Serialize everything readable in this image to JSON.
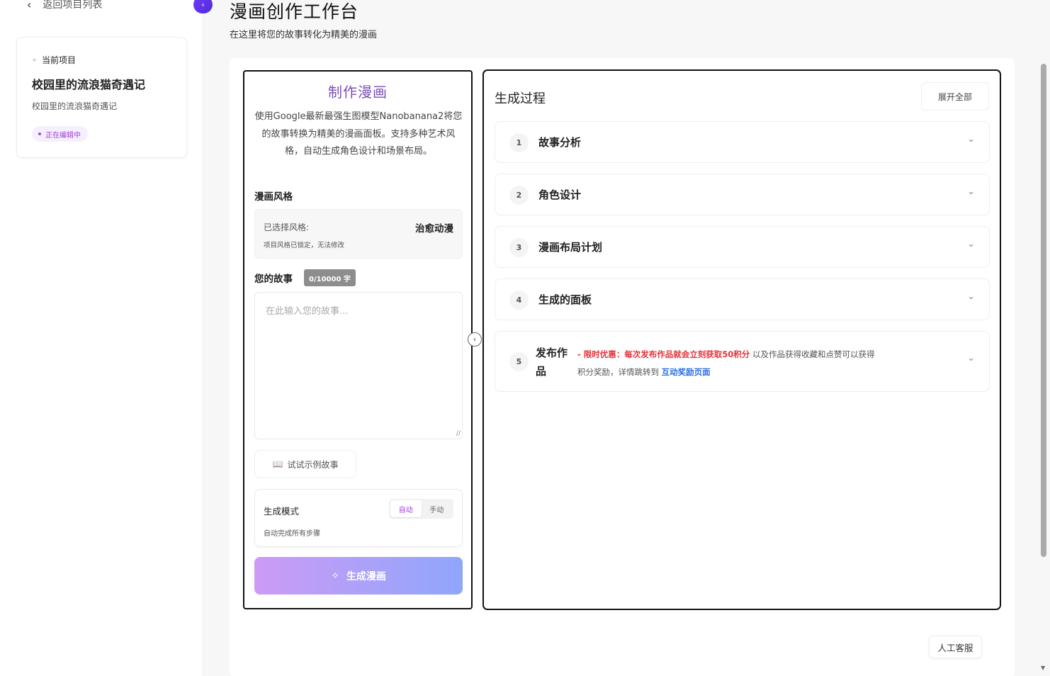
{
  "sidebar": {
    "back_label": "返回项目列表",
    "current_project_label": "当前项目",
    "project_title": "校园里的流浪猫奇遇记",
    "project_subtitle": "校园里的流浪猫奇遇记",
    "status_badge": "正在编辑中"
  },
  "header": {
    "title": "漫画创作工作台",
    "subtitle": "在这里将您的故事转化为精美的漫画"
  },
  "left_panel": {
    "title": "制作漫画",
    "description": "使用Google最新最强生图模型Nanobanana2将您的故事转换为精美的漫画面板。支持多种艺术风格，自动生成角色设计和场景布局。",
    "style_section": "漫画风格",
    "selected_style_label": "已选择风格:",
    "selected_style_value": "治愈动漫",
    "style_locked_note": "项目风格已锁定，无法修改",
    "story_section": "您的故事",
    "char_count": "0/10000 字",
    "story_placeholder": "在此输入您的故事...",
    "example_button": "试试示例故事",
    "mode_label": "生成模式",
    "mode_options": [
      "自动",
      "手动"
    ],
    "mode_hint": "自动完成所有步骤",
    "generate_button": "生成漫画"
  },
  "right_panel": {
    "title": "生成过程",
    "expand_all": "展开全部",
    "steps": [
      {
        "num": "1",
        "name": "故事分析"
      },
      {
        "num": "2",
        "name": "角色设计"
      },
      {
        "num": "3",
        "name": "漫画布局计划"
      },
      {
        "num": "4",
        "name": "生成的面板"
      },
      {
        "num": "5",
        "name": "发布作品"
      }
    ],
    "promo_prefix": "- ",
    "promo_highlight": "限时优惠：每次发布作品就会立刻获取50积分",
    "promo_mid": " 以及作品获得收藏和点赞可以获得积分奖励，详情跳转到 ",
    "promo_link": "互动奖励页面"
  },
  "support_button": "人工客服",
  "colors": {
    "accent_purple": "#a43fd6",
    "promo_red": "#e5323b",
    "link_blue": "#2b6fe0",
    "generate_gradient_start": "#cc9bf6",
    "generate_gradient_end": "#8fa6fb"
  },
  "icons": {
    "back": "chevron-left-icon",
    "collapse": "chevron-left-icon",
    "example": "book-icon",
    "generate": "sparkle-icon",
    "step_toggle": "chevron-down-icon"
  }
}
